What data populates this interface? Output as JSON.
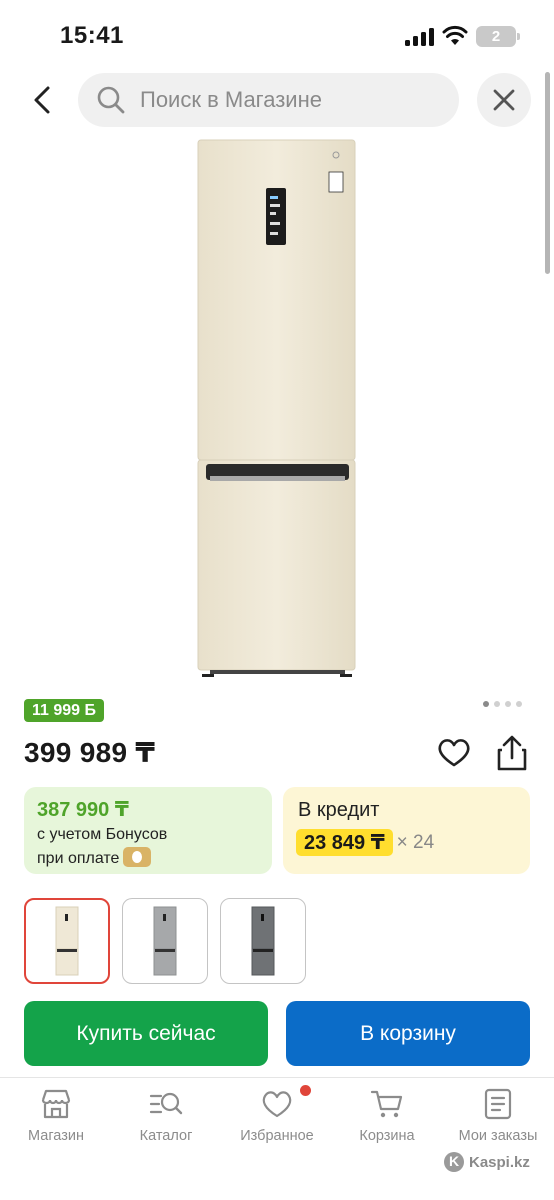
{
  "status_bar": {
    "time": "15:41",
    "battery": "2"
  },
  "header": {
    "search_placeholder": "Поиск в Магазине"
  },
  "product": {
    "bonus_badge": "11 999 Б",
    "price": "399 989 ₸",
    "image_count": 4,
    "image_active": 1
  },
  "bonus_card": {
    "price": "387 990 ₸",
    "line1": "с учетом Бонусов",
    "line2": "при оплате"
  },
  "credit_card": {
    "title": "В кредит",
    "amount": "23 849 ₸",
    "months": "× 24"
  },
  "variants": [
    {
      "color": "#efe8d6",
      "selected": true
    },
    {
      "color": "#a6a8aa",
      "selected": false
    },
    {
      "color": "#6f7275",
      "selected": false
    }
  ],
  "actions": {
    "buy_now": "Купить сейчас",
    "add_to_cart": "В корзину"
  },
  "bottom_nav": {
    "items": [
      {
        "label": "Магазин",
        "icon": "store-icon"
      },
      {
        "label": "Каталог",
        "icon": "catalog-search-icon"
      },
      {
        "label": "Избранное",
        "icon": "heart-icon"
      },
      {
        "label": "Корзина",
        "icon": "cart-icon"
      },
      {
        "label": "Мои заказы",
        "icon": "orders-icon"
      }
    ]
  },
  "watermark": "Kaspi.kz",
  "colors": {
    "green": "#4fa42a",
    "buy_button": "#14a34a",
    "cart_button": "#0b6cc8",
    "credit_highlight": "#ffde2e",
    "selected_border": "#e0453a"
  }
}
